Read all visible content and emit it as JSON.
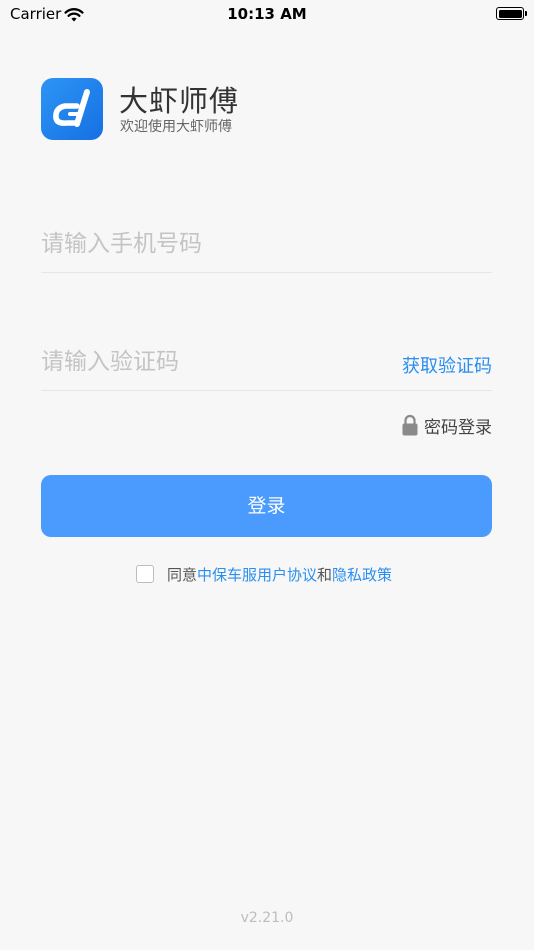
{
  "status_bar": {
    "carrier": "Carrier",
    "time": "10:13 AM",
    "wifi_icon": "wifi-icon",
    "battery_icon": "battery-icon"
  },
  "brand": {
    "logo_icon": "app-logo-icon",
    "app_name": "大虾师傅",
    "welcome": "欢迎使用大虾师傅"
  },
  "form": {
    "phone_placeholder": "请输入手机号码",
    "phone_value": "",
    "code_placeholder": "请输入验证码",
    "code_value": "",
    "get_code_label": "获取验证码",
    "password_login_label": "密码登录",
    "lock_icon": "lock-icon",
    "login_label": "登录"
  },
  "agreement": {
    "checked": false,
    "prefix": "同意",
    "user_agreement": "中保车服用户协议",
    "and": "和",
    "privacy_policy": "隐私政策"
  },
  "footer": {
    "version": "v2.21.0"
  },
  "colors": {
    "accent": "#2b8ef0",
    "button": "#4a9bfd",
    "background": "#f7f7f7"
  }
}
